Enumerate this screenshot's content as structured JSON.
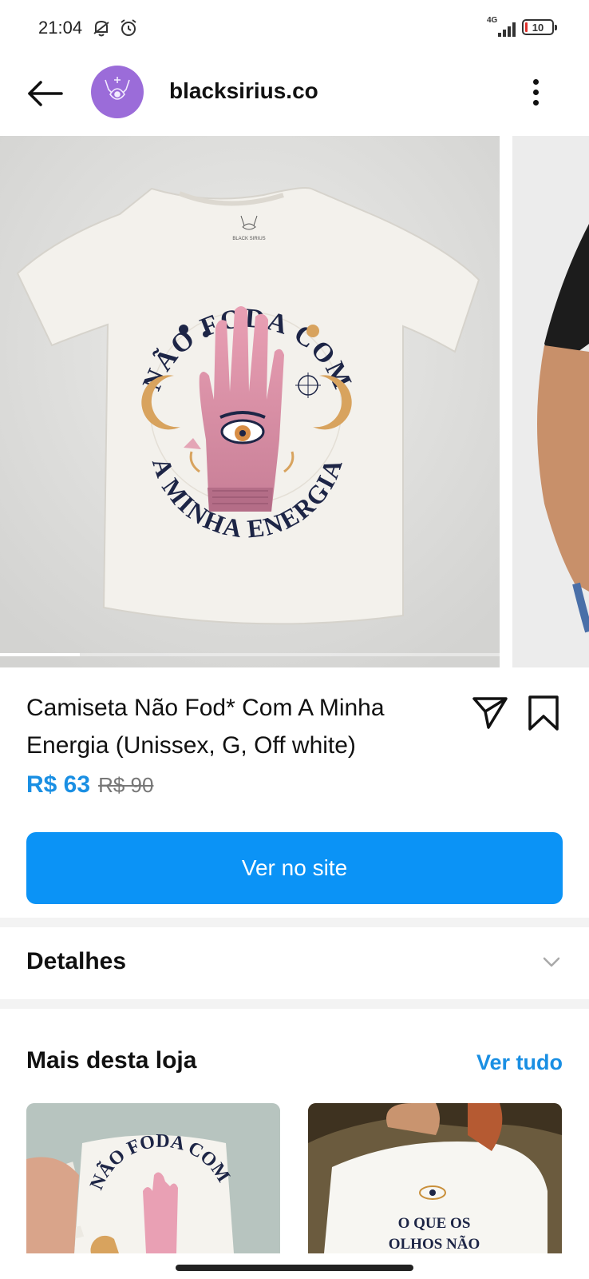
{
  "status_bar": {
    "time": "21:04",
    "network": "4G",
    "battery": "10",
    "icons": [
      "mute-icon",
      "alarm-icon",
      "signal-icon",
      "battery-icon"
    ]
  },
  "header": {
    "shop_name": "blacksirius.co",
    "icons": [
      "back-arrow-icon",
      "more-vertical-icon"
    ]
  },
  "carousel": {
    "shirt_text_top": "NÃO FODA COM",
    "shirt_text_bottom": "A MINHA ENERGIA",
    "brand_tag": "BLACK SIRIUS",
    "progress": 0.16
  },
  "product": {
    "title": "Camiseta Não Fod* Com A Minha Energia (Unissex, G, Off white)",
    "price": "R$ 63",
    "old_price": "R$ 90",
    "icons": [
      "share-icon",
      "bookmark-icon"
    ]
  },
  "cta": {
    "label": "Ver no site"
  },
  "details": {
    "label": "Detalhes",
    "icon": "chevron-down-icon"
  },
  "more_from_store": {
    "title": "Mais desta loja",
    "see_all": "Ver tudo",
    "items": [
      {
        "image_text": "NÃO FODA COM"
      },
      {
        "image_text_1": "O QUE OS",
        "image_text_2": "OLHOS NÃO"
      }
    ]
  },
  "colors": {
    "accent": "#0b93f6",
    "price": "#1a8fe3",
    "avatar": "#9b6cd9"
  }
}
